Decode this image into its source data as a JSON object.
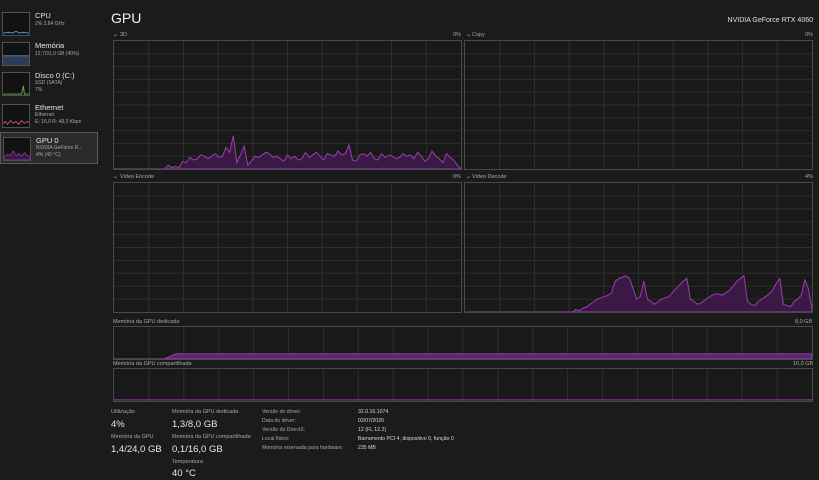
{
  "page": {
    "title": "GPU",
    "device": "NVIDIA GeForce RTX 4060"
  },
  "sidebar": {
    "items": [
      {
        "name": "CPU",
        "sub": [
          "2% 3,84 GHz"
        ]
      },
      {
        "name": "Memória",
        "sub": [
          "12,7/31,9 GB (40%)"
        ]
      },
      {
        "name": "Disco 0 (C:)",
        "sub": [
          "SSD (SATA)",
          "7%"
        ]
      },
      {
        "name": "Ethernet",
        "sub": [
          "Ethernet",
          "E: 16,0 R: 48,0 Kbps"
        ]
      },
      {
        "name": "GPU 0",
        "sub": [
          "NVIDIA GeForce R...",
          "4% (40 °C)"
        ]
      }
    ]
  },
  "engines": [
    {
      "name": "3D",
      "value": "0%"
    },
    {
      "name": "Copy",
      "value": "0%"
    },
    {
      "name": "Video Encode",
      "value": "0%"
    },
    {
      "name": "Video Decode",
      "value": "4%"
    }
  ],
  "dedicated": {
    "label": "Memória da GPU dedicada",
    "max": "8,0 GB",
    "usage_fraction": 0.1625
  },
  "shared": {
    "label": "Memória da GPU compartilhada",
    "max": "16,0 GB",
    "usage_fraction": 0.006
  },
  "stats": {
    "utilizacao": {
      "label": "Utilização",
      "value": "4%"
    },
    "memoria_gpu": {
      "label": "Memória da GPU",
      "value": "1,4/24,0 GB"
    },
    "dedicada": {
      "label": "Memória da GPU dedicada",
      "value": "1,3/8,0 GB"
    },
    "compartilhada": {
      "label": "Memória da GPU compartilhada",
      "value": "0,1/16,0 GB"
    },
    "temperatura": {
      "label": "Temperatura",
      "value": "40 °C"
    }
  },
  "info": [
    {
      "label": "Versão do driver:",
      "value": "32.0.16.1074"
    },
    {
      "label": "Data do driver:",
      "value": "02/07/2026"
    },
    {
      "label": "Versão do DirectX:",
      "value": "12 (FL 12.2)"
    },
    {
      "label": "Local físico:",
      "value": "Barramento PCI 4, dispositivo 0, função 0"
    },
    {
      "label": "Memória reservada para hardware:",
      "value": "235 MB"
    }
  ],
  "colors": {
    "accent": "#9b3fae",
    "fill": "#3a1a45",
    "grid": "#2e2e2e",
    "border": "#4a4a4a"
  },
  "series": {
    "engine_3d": [
      0,
      0,
      0,
      0,
      0,
      0,
      0,
      0,
      0,
      0,
      0,
      0,
      0,
      0,
      0,
      3,
      1,
      2,
      1,
      6,
      5,
      9,
      7,
      8,
      11,
      10,
      8,
      10,
      12,
      9,
      10,
      17,
      13,
      26,
      5,
      11,
      18,
      3,
      6,
      10,
      9,
      11,
      13,
      12,
      9,
      10,
      8,
      6,
      11,
      8,
      10,
      7,
      8,
      13,
      9,
      11,
      13,
      10,
      7,
      12,
      11,
      10,
      14,
      11,
      12,
      19,
      7,
      6,
      11,
      12,
      10,
      13,
      8,
      7,
      12,
      9,
      11,
      10,
      8,
      9,
      12,
      10,
      11,
      8,
      13,
      10,
      6,
      8,
      14,
      10,
      8,
      5,
      12,
      9,
      7,
      3,
      0
    ],
    "video_decode": [
      0,
      0,
      0,
      0,
      0,
      0,
      0,
      0,
      0,
      0,
      0,
      0,
      0,
      0,
      0,
      0,
      0,
      0,
      0,
      0,
      0,
      0,
      0,
      0,
      0,
      0,
      0,
      0,
      0,
      0,
      0,
      2,
      1,
      3,
      4,
      6,
      8,
      10,
      11,
      12,
      13,
      15,
      24,
      26,
      27,
      28,
      26,
      18,
      10,
      12,
      24,
      10,
      8,
      6,
      8,
      10,
      11,
      12,
      15,
      18,
      21,
      24,
      26,
      10,
      8,
      6,
      7,
      9,
      11,
      13,
      14,
      14,
      13,
      15,
      17,
      20,
      24,
      26,
      28,
      8,
      6,
      5,
      8,
      10,
      12,
      14,
      17,
      22,
      26,
      6,
      5,
      4,
      8,
      10,
      13,
      25,
      18,
      2
    ]
  }
}
